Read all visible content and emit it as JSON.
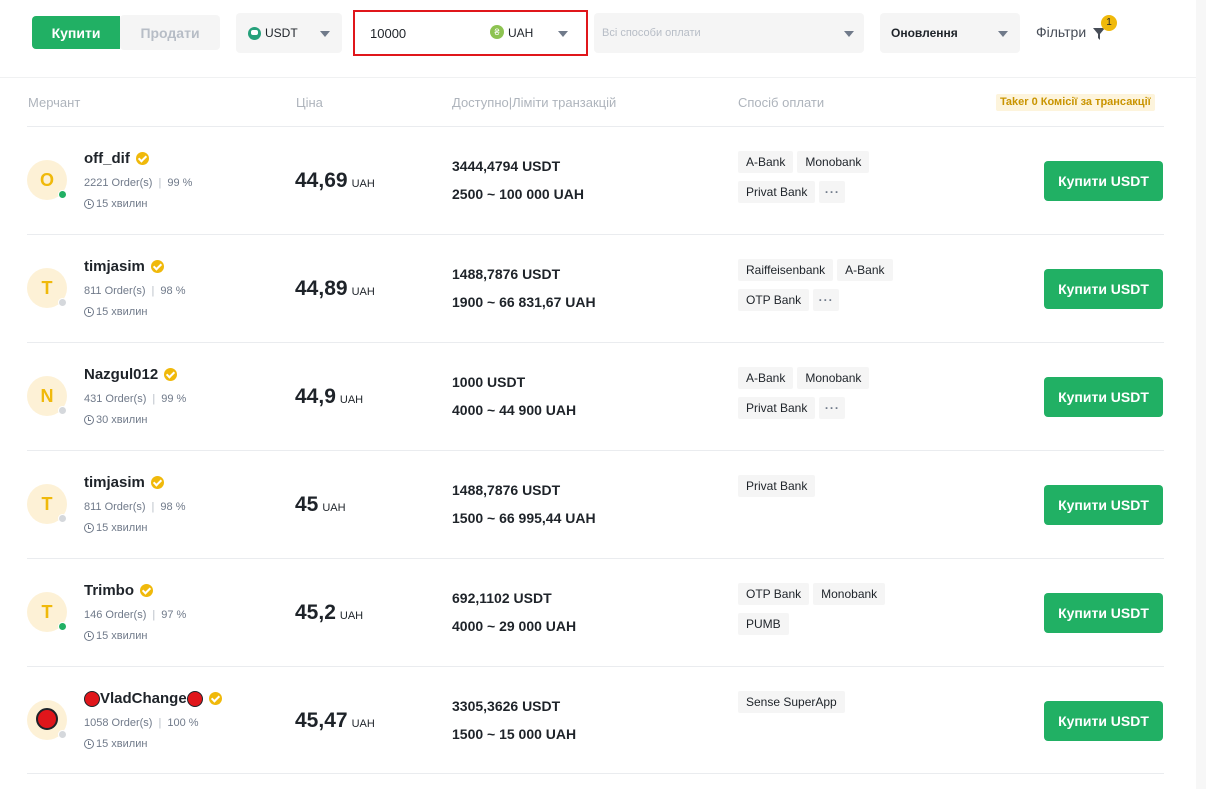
{
  "toolbar": {
    "buy_label": "Купити",
    "sell_label": "Продати",
    "asset": "USDT",
    "asset_icon": "tether-icon",
    "amount": "10000",
    "fiat": "UAH",
    "fiat_icon": "hryvnia-icon",
    "payment_placeholder": "Всі способи оплати",
    "refresh_label": "Оновлення",
    "filters_label": "Фільтри",
    "filters_count": "1"
  },
  "table": {
    "headers": {
      "merchant": "Мерчант",
      "price": "Ціна",
      "available": "Доступно|Ліміти транзакцій",
      "payment": "Спосіб оплати"
    },
    "taker_note": "Taker 0 Комісії за трансакції",
    "rows": [
      {
        "initial": "O",
        "name": "off_dif",
        "online": true,
        "orders": "2221 Order(s)",
        "completion": "99 %",
        "time": "15 хвилин",
        "price": "44,69",
        "unit": "UAH",
        "available": "3444,4794 USDT",
        "limits": "2500 ~ 100 000 UAH",
        "methods": [
          "A-Bank",
          "Monobank",
          "Privat Bank"
        ],
        "more": true,
        "action": "Купити USDT"
      },
      {
        "initial": "T",
        "name": "timjasim",
        "online": false,
        "orders": "811 Order(s)",
        "completion": "98 %",
        "time": "15 хвилин",
        "price": "44,89",
        "unit": "UAH",
        "available": "1488,7876 USDT",
        "limits": "1900 ~ 66 831,67 UAH",
        "methods": [
          "Raiffeisenbank",
          "A-Bank",
          "OTP Bank"
        ],
        "more": true,
        "action": "Купити USDT"
      },
      {
        "initial": "N",
        "name": "Nazgul012",
        "online": false,
        "orders": "431 Order(s)",
        "completion": "99 %",
        "time": "30 хвилин",
        "price": "44,9",
        "unit": "UAH",
        "available": "1000 USDT",
        "limits": "4000 ~ 44 900 UAH",
        "methods": [
          "A-Bank",
          "Monobank",
          "Privat Bank"
        ],
        "more": true,
        "action": "Купити USDT"
      },
      {
        "initial": "T",
        "name": "timjasim",
        "online": false,
        "orders": "811 Order(s)",
        "completion": "98 %",
        "time": "15 хвилин",
        "price": "45",
        "unit": "UAH",
        "available": "1488,7876 USDT",
        "limits": "1500 ~ 66 995,44 UAH",
        "methods": [
          "Privat Bank"
        ],
        "more": false,
        "action": "Купити USDT"
      },
      {
        "initial": "T",
        "name": "Trimbo",
        "online": true,
        "orders": "146 Order(s)",
        "completion": "97 %",
        "time": "15 хвилин",
        "price": "45,2",
        "unit": "UAH",
        "available": "692,1102 USDT",
        "limits": "4000 ~ 29 000 UAH",
        "methods": [
          "OTP Bank",
          "Monobank",
          "PUMB"
        ],
        "more": false,
        "action": "Купити USDT"
      },
      {
        "initial": "",
        "avatar_icon": "red-circle-icon",
        "name": "VladChange",
        "name_emoji": "red-circle-icon",
        "online": false,
        "orders": "1058 Order(s)",
        "completion": "100 %",
        "time": "15 хвилин",
        "price": "45,47",
        "unit": "UAH",
        "available": "3305,3626 USDT",
        "limits": "1500 ~ 15 000 UAH",
        "methods": [
          "Sense SuperApp"
        ],
        "more": false,
        "action": "Купити USDT"
      }
    ]
  }
}
